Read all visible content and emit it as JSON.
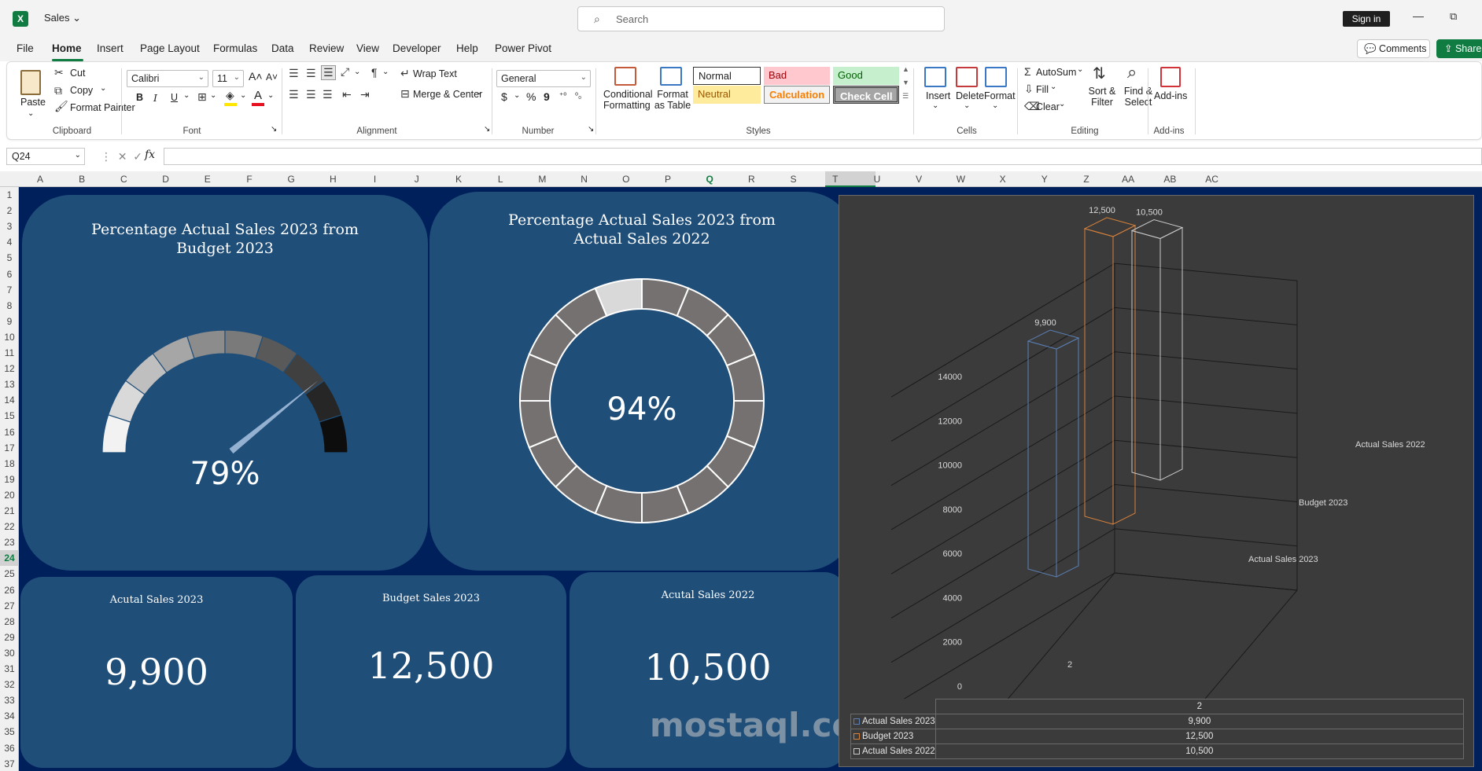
{
  "app": {
    "title": "Sales ⌄",
    "search_placeholder": "Search",
    "sign_in": "Sign in"
  },
  "menu": {
    "items": [
      "File",
      "Home",
      "Insert",
      "Page Layout",
      "Formulas",
      "Data",
      "Review",
      "View",
      "Developer",
      "Help",
      "Power Pivot"
    ],
    "comments": "Comments",
    "share": "Share"
  },
  "ribbon": {
    "clipboard": {
      "paste": "Paste",
      "cut": "Cut",
      "copy": "Copy",
      "format_painter": "Format Painter",
      "label": "Clipboard"
    },
    "font": {
      "name": "Calibri",
      "size": "11",
      "bold": "B",
      "italic": "I",
      "underline": "U",
      "label": "Font"
    },
    "alignment": {
      "wrap_text": "Wrap Text",
      "merge_center": "Merge & Center",
      "label": "Alignment"
    },
    "number": {
      "format": "General",
      "currency": "$",
      "percent": "%",
      "comma": "9",
      "label": "Number"
    },
    "styles": {
      "conditional_formatting": "Conditional Formatting",
      "format_as_table": "Format as Table",
      "normal": "Normal",
      "bad": "Bad",
      "good": "Good",
      "neutral": "Neutral",
      "calculation": "Calculation",
      "check_cell": "Check Cell",
      "label": "Styles"
    },
    "cells": {
      "insert": "Insert",
      "delete": "Delete",
      "format": "Format",
      "label": "Cells"
    },
    "editing": {
      "autosum": "AutoSum",
      "fill": "Fill",
      "clear": "Clear",
      "sort_filter": "Sort & Filter",
      "find_select": "Find & Select",
      "label": "Editing"
    },
    "addins": {
      "addins": "Add-ins",
      "label": "Add-ins"
    }
  },
  "formula_bar": {
    "name_box": "Q24",
    "fx": "fx",
    "formula": ""
  },
  "columns": [
    "A",
    "B",
    "C",
    "D",
    "E",
    "F",
    "G",
    "H",
    "I",
    "J",
    "K",
    "L",
    "M",
    "N",
    "O",
    "P",
    "Q",
    "R",
    "S",
    "T",
    "U",
    "V",
    "W",
    "X",
    "Y",
    "Z",
    "AA",
    "AB",
    "AC"
  ],
  "selected_column": "Q",
  "rows": [
    "1",
    "2",
    "3",
    "4",
    "5",
    "6",
    "7",
    "8",
    "9",
    "10",
    "11",
    "12",
    "13",
    "14",
    "15",
    "16",
    "17",
    "18",
    "19",
    "20",
    "21",
    "22",
    "23",
    "24",
    "25",
    "26",
    "27",
    "28",
    "29",
    "30",
    "31",
    "32",
    "33",
    "34",
    "35",
    "36",
    "37"
  ],
  "selected_row": "24",
  "dashboard": {
    "gauge": {
      "title": "Percentage Actual Sales 2023 from Budget 2023",
      "value_text": "79%",
      "fraction": 0.79
    },
    "donut": {
      "title": "Percentage Actual Sales 2023 from Actual Sales 2022",
      "value_text": "94%",
      "fraction": 0.94
    },
    "kpis": [
      {
        "title": "Acutal Sales 2023",
        "value": "9,900"
      },
      {
        "title": "Budget Sales 2023",
        "value": "12,500"
      },
      {
        "title": "Acutal Sales 2022",
        "value": "10,500"
      }
    ],
    "watermark": "mostaql.com"
  },
  "chart_data": {
    "type": "bar",
    "subtype": "3d-column",
    "categories": [
      "2"
    ],
    "series": [
      {
        "name": "Actual Sales 2023",
        "values": [
          9900
        ],
        "color": "#5b7fb4"
      },
      {
        "name": "Budget 2023",
        "values": [
          12500
        ],
        "color": "#d9823b"
      },
      {
        "name": "Actual Sales 2022",
        "values": [
          10500
        ],
        "color": "#c9c9c9"
      }
    ],
    "data_labels": [
      "9,900",
      "12,500",
      "10,500"
    ],
    "ylim": [
      0,
      14000
    ],
    "y_ticks": [
      "0",
      "2000",
      "4000",
      "6000",
      "8000",
      "10000",
      "12000",
      "14000"
    ],
    "grid": true,
    "legend": "data-table",
    "table_header": "2"
  }
}
